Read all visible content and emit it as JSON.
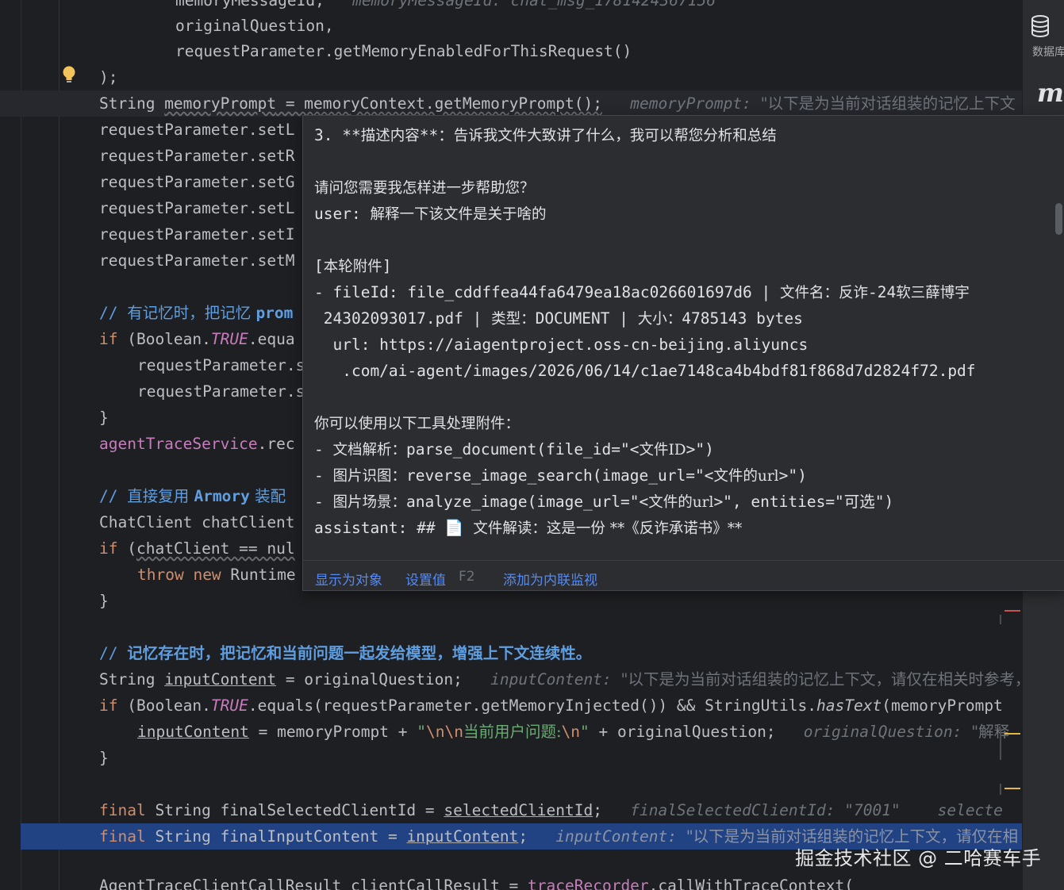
{
  "code": {
    "l0a": "memoryMessageId,",
    "l0b": "memoryMessageId: ",
    "l0c": "chat_msg_1781424367156",
    "l1": "originalQuestion,",
    "l2a": "requestParameter.",
    "l2b": "getMemoryEnabledForThisRequest",
    "l2c": "()",
    "l3": ");",
    "l4_type": "String ",
    "l4_var": "memoryPrompt",
    "l4_rest": " = memoryContext.getMemoryPrompt();",
    "l4_hint": "memoryPrompt: ",
    "l4_val": "\"以下是为当前对话组装的记忆上下文",
    "l5": "requestParameter.setL",
    "l6": "requestParameter.setR",
    "l7": "requestParameter.setG",
    "l8": "requestParameter.setL",
    "l9": "requestParameter.setI",
    "l10": "requestParameter.setM",
    "l12_slash": "// ",
    "l12_cmt": "有记忆时，把记忆 ",
    "l12_tail": "prom",
    "l13_if": "if ",
    "l13_a": "(Boolean.",
    "l13_true": "TRUE",
    "l13_b": ".equa",
    "l14": "requestParameter.s",
    "l15": "requestParameter.s",
    "l16": "}",
    "l17_field": "agentTraceService",
    "l17_rest": ".rec",
    "l19_slash": "// ",
    "l19_cmt": "直接复用 ",
    "l19_arm": "Armory",
    "l19_cmt2": " 装配",
    "l20": "ChatClient chatClient",
    "l21_if": "if ",
    "l21_a": "(",
    "l21_b": "chatClient == nul",
    "l22_throw": "throw ",
    "l22_new": "new ",
    "l22_rest": "Runtime",
    "l23": "}",
    "l25_slash": "// ",
    "l25_cmt": "记忆存在时，把记忆和当前问题一起发给模型，增强上下文连续性。",
    "l26_type": "String ",
    "l26_var": "inputContent",
    "l26_rest": " = originalQuestion;",
    "l26_hint": "inputContent: ",
    "l26_val": "\"以下是为当前对话组装的记忆上下文，请仅在相关时参考，",
    "l27_if": "if ",
    "l27_a": "(Boolean.",
    "l27_true": "TRUE",
    "l27_b": ".equals(requestParameter.getMemoryInjected()) && StringUtils.",
    "l27_has": "hasText",
    "l27_c": "(memoryPrompt",
    "l28_var": "inputContent",
    "l28_a": " = memoryPrompt + ",
    "l28_s1": "\"",
    "l28_esc1": "\\n\\n",
    "l28_s2": "当前用户问题:",
    "l28_esc2": "\\n",
    "l28_s3": "\"",
    "l28_b": " + originalQuestion;",
    "l28_hint": "originalQuestion: ",
    "l28_val": "\"解释",
    "l29": "}",
    "l31_final": "final ",
    "l31_rest": "String finalSelectedClientId = ",
    "l31_var": "selectedClientId",
    "l31_semi": ";",
    "l31_hint": "finalSelectedClientId: \"7001\"",
    "l31_hint2": "selecte",
    "l32_final": "final ",
    "l32_rest": "String finalInputContent = ",
    "l32_var": "inputContent",
    "l32_semi": ";",
    "l32_hint": "inputContent: ",
    "l32_val": "\"以下是为当前对话组装的记忆上下文，请仅在相",
    "l34a": "AgentTraceClientCallResult clientCallResult = ",
    "l34b": "traceRecorder",
    "l34c": ".callWithTraceContext("
  },
  "popup": {
    "lines": [
      {
        "a": "3. **",
        "b": "描述内容",
        "c": "**：",
        "d": "告诉我文件大致讲了什么，我可以帮您分析和总结",
        "e": ""
      },
      {
        "a": "",
        "b": "",
        "c": "",
        "d": "",
        "e": ""
      },
      {
        "a": "",
        "b": "请问您需要我怎样进一步帮助您？",
        "c": "",
        "d": "",
        "e": ""
      },
      {
        "a": "user: ",
        "b": "解释一下该文件是关于啥的",
        "c": "",
        "d": "",
        "e": ""
      },
      {
        "a": "",
        "b": "",
        "c": "",
        "d": "",
        "e": ""
      },
      {
        "a": "[",
        "b": "本轮附件",
        "c": "]",
        "d": "",
        "e": ""
      },
      {
        "a": "- fileId: file_cddffea44fa6479ea18ac026601697d6 | ",
        "b": "文件名：反诈",
        "c": "-24",
        "d": "软三薛博宇",
        "e": ""
      },
      {
        "a": " 24302093017.pdf | ",
        "b": "类型：",
        "c": "DOCUMENT | ",
        "d": "大小：",
        "e": "4785143 bytes"
      },
      {
        "a": "  url: https://aiagentproject.oss-cn-beijing.aliyuncs",
        "b": "",
        "c": "",
        "d": "",
        "e": ""
      },
      {
        "a": "   .com/ai-agent/images/2026/06/14/c1ae7148ca4b4bdf81f868d7d2824f72.pdf",
        "b": "",
        "c": "",
        "d": "",
        "e": ""
      },
      {
        "a": "",
        "b": "",
        "c": "",
        "d": "",
        "e": ""
      },
      {
        "a": "",
        "b": "你可以使用以下工具处理附件：",
        "c": "",
        "d": "",
        "e": ""
      },
      {
        "a": "- ",
        "b": "文档解析：",
        "c": "parse_document(file_id=\"<",
        "d": "文件ID",
        "e": ">\")"
      },
      {
        "a": "- ",
        "b": "图片识图：",
        "c": "reverse_image_search(image_url=\"<",
        "d": "文件的url",
        "e": ">\")"
      },
      {
        "a": "- ",
        "b": "图片场景：",
        "c": "analyze_image(image_url=\"<",
        "d": "文件的url",
        "e": ">\", entities=\"可选\")"
      },
      {
        "a": "assistant: ## ",
        "b": "📄",
        "c": " ",
        "d": "文件解读：这是一份 ",
        "e": "**《反诈承诺书》**"
      }
    ],
    "footer": {
      "view_as_object": "显示为对象",
      "set_value": "设置值",
      "set_value_shortcut": "F2",
      "add_inline_watch": "添加为内联监视"
    }
  },
  "toolstrip": {
    "database_label": "数据库",
    "database_icon": "database-icon",
    "m_icon": "m",
    "m_icon_name": "mybatis-m-icon"
  },
  "watermark": "掘金技术社区 @ 二哈赛车手",
  "colors": {
    "background": "#1e1f22",
    "popup_bg": "#2b2d30",
    "keyword": "#cf8e6d",
    "field": "#c77dbb",
    "string": "#6aab73",
    "comment": "#5f9ee0",
    "hint": "#6f737a",
    "link": "#548af7",
    "selection": "#214283"
  }
}
